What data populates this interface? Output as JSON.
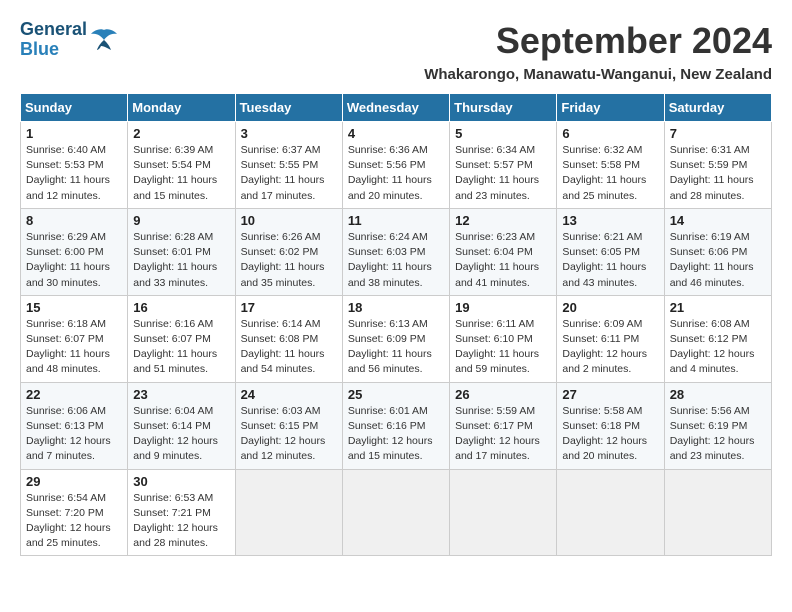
{
  "header": {
    "logo_general": "General",
    "logo_blue": "Blue",
    "month_title": "September 2024",
    "location": "Whakarongo, Manawatu-Wanganui, New Zealand"
  },
  "calendar": {
    "days_of_week": [
      "Sunday",
      "Monday",
      "Tuesday",
      "Wednesday",
      "Thursday",
      "Friday",
      "Saturday"
    ],
    "weeks": [
      [
        null,
        {
          "day": "2",
          "sunrise": "6:39 AM",
          "sunset": "5:54 PM",
          "daylight": "11 hours and 15 minutes."
        },
        {
          "day": "3",
          "sunrise": "6:37 AM",
          "sunset": "5:55 PM",
          "daylight": "11 hours and 17 minutes."
        },
        {
          "day": "4",
          "sunrise": "6:36 AM",
          "sunset": "5:56 PM",
          "daylight": "11 hours and 20 minutes."
        },
        {
          "day": "5",
          "sunrise": "6:34 AM",
          "sunset": "5:57 PM",
          "daylight": "11 hours and 23 minutes."
        },
        {
          "day": "6",
          "sunrise": "6:32 AM",
          "sunset": "5:58 PM",
          "daylight": "11 hours and 25 minutes."
        },
        {
          "day": "7",
          "sunrise": "6:31 AM",
          "sunset": "5:59 PM",
          "daylight": "11 hours and 28 minutes."
        }
      ],
      [
        {
          "day": "1",
          "sunrise": "6:40 AM",
          "sunset": "5:53 PM",
          "daylight": "11 hours and 12 minutes."
        },
        {
          "day": "9",
          "sunrise": "6:28 AM",
          "sunset": "6:01 PM",
          "daylight": "11 hours and 33 minutes."
        },
        {
          "day": "10",
          "sunrise": "6:26 AM",
          "sunset": "6:02 PM",
          "daylight": "11 hours and 35 minutes."
        },
        {
          "day": "11",
          "sunrise": "6:24 AM",
          "sunset": "6:03 PM",
          "daylight": "11 hours and 38 minutes."
        },
        {
          "day": "12",
          "sunrise": "6:23 AM",
          "sunset": "6:04 PM",
          "daylight": "11 hours and 41 minutes."
        },
        {
          "day": "13",
          "sunrise": "6:21 AM",
          "sunset": "6:05 PM",
          "daylight": "11 hours and 43 minutes."
        },
        {
          "day": "14",
          "sunrise": "6:19 AM",
          "sunset": "6:06 PM",
          "daylight": "11 hours and 46 minutes."
        }
      ],
      [
        {
          "day": "8",
          "sunrise": "6:29 AM",
          "sunset": "6:00 PM",
          "daylight": "11 hours and 30 minutes."
        },
        {
          "day": "16",
          "sunrise": "6:16 AM",
          "sunset": "6:07 PM",
          "daylight": "11 hours and 51 minutes."
        },
        {
          "day": "17",
          "sunrise": "6:14 AM",
          "sunset": "6:08 PM",
          "daylight": "11 hours and 54 minutes."
        },
        {
          "day": "18",
          "sunrise": "6:13 AM",
          "sunset": "6:09 PM",
          "daylight": "11 hours and 56 minutes."
        },
        {
          "day": "19",
          "sunrise": "6:11 AM",
          "sunset": "6:10 PM",
          "daylight": "11 hours and 59 minutes."
        },
        {
          "day": "20",
          "sunrise": "6:09 AM",
          "sunset": "6:11 PM",
          "daylight": "12 hours and 2 minutes."
        },
        {
          "day": "21",
          "sunrise": "6:08 AM",
          "sunset": "6:12 PM",
          "daylight": "12 hours and 4 minutes."
        }
      ],
      [
        {
          "day": "15",
          "sunrise": "6:18 AM",
          "sunset": "6:07 PM",
          "daylight": "11 hours and 48 minutes."
        },
        {
          "day": "23",
          "sunrise": "6:04 AM",
          "sunset": "6:14 PM",
          "daylight": "12 hours and 9 minutes."
        },
        {
          "day": "24",
          "sunrise": "6:03 AM",
          "sunset": "6:15 PM",
          "daylight": "12 hours and 12 minutes."
        },
        {
          "day": "25",
          "sunrise": "6:01 AM",
          "sunset": "6:16 PM",
          "daylight": "12 hours and 15 minutes."
        },
        {
          "day": "26",
          "sunrise": "5:59 AM",
          "sunset": "6:17 PM",
          "daylight": "12 hours and 17 minutes."
        },
        {
          "day": "27",
          "sunrise": "5:58 AM",
          "sunset": "6:18 PM",
          "daylight": "12 hours and 20 minutes."
        },
        {
          "day": "28",
          "sunrise": "5:56 AM",
          "sunset": "6:19 PM",
          "daylight": "12 hours and 23 minutes."
        }
      ],
      [
        {
          "day": "22",
          "sunrise": "6:06 AM",
          "sunset": "6:13 PM",
          "daylight": "12 hours and 7 minutes."
        },
        {
          "day": "30",
          "sunrise": "6:53 AM",
          "sunset": "7:21 PM",
          "daylight": "12 hours and 28 minutes."
        },
        null,
        null,
        null,
        null,
        null
      ],
      [
        {
          "day": "29",
          "sunrise": "6:54 AM",
          "sunset": "7:20 PM",
          "daylight": "12 hours and 25 minutes."
        },
        null,
        null,
        null,
        null,
        null,
        null
      ]
    ]
  }
}
